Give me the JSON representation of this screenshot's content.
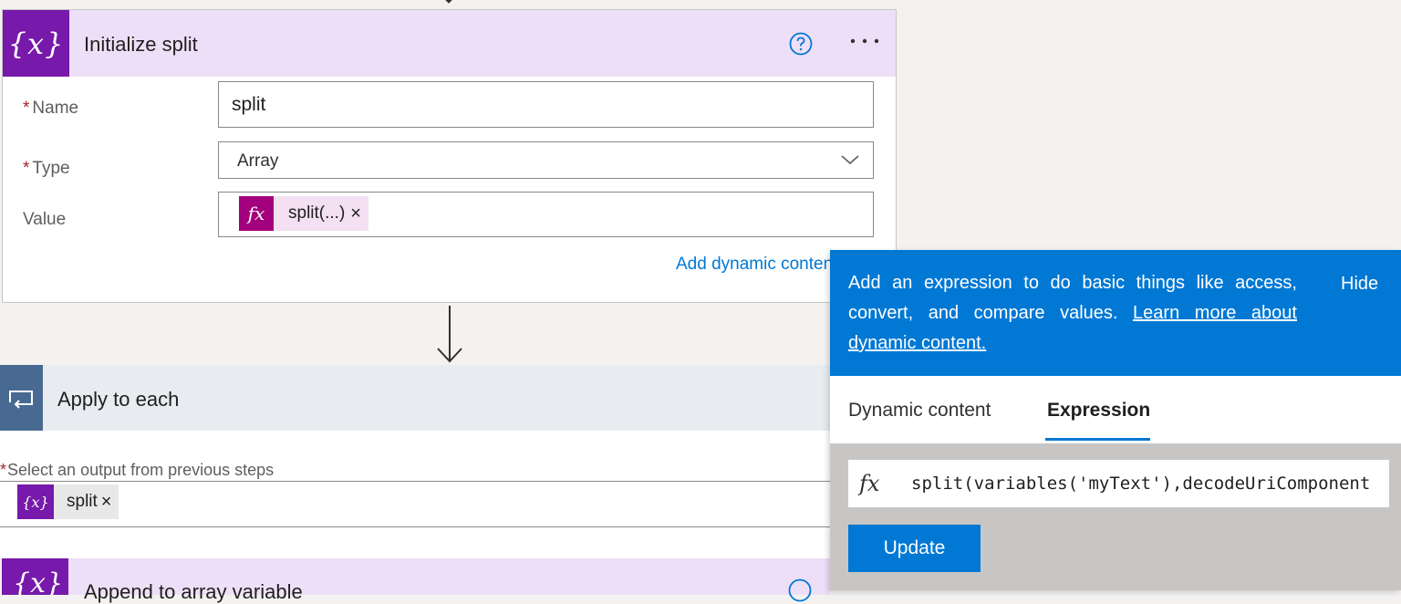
{
  "initialize_card": {
    "title": "Initialize split",
    "icon": "variable-icon",
    "fields": {
      "name_label": "Name",
      "name_value": "split",
      "type_label": "Type",
      "type_value": "Array",
      "value_label": "Value",
      "value_token": "split(...)",
      "required_marker": "*"
    },
    "add_dynamic_link": "Add dynamic content"
  },
  "apply_card": {
    "title": "Apply to each",
    "icon": "loop-icon",
    "select_label": "Select an output from previous steps",
    "required_marker": "*",
    "token": "split"
  },
  "append_card": {
    "title": "Append to array variable",
    "icon": "variable-icon"
  },
  "panel": {
    "description": "Add an expression to do basic things like access, convert, and compare values.",
    "learn_more": "Learn more about dynamic content.",
    "hide_label": "Hide",
    "tabs": [
      "Dynamic content",
      "Expression"
    ],
    "active_tab": "Expression",
    "expression_value": "split(variables('myText'),decodeUriComponent",
    "update_label": "Update"
  },
  "glyphs": {
    "var": "{x}",
    "fx": "fx",
    "close": "×"
  },
  "colors": {
    "accent": "#0078d4",
    "variable_purple": "#7719aa",
    "expression_magenta": "#a3007d",
    "loop_blue": "#486991",
    "required_red": "#a4262c"
  }
}
